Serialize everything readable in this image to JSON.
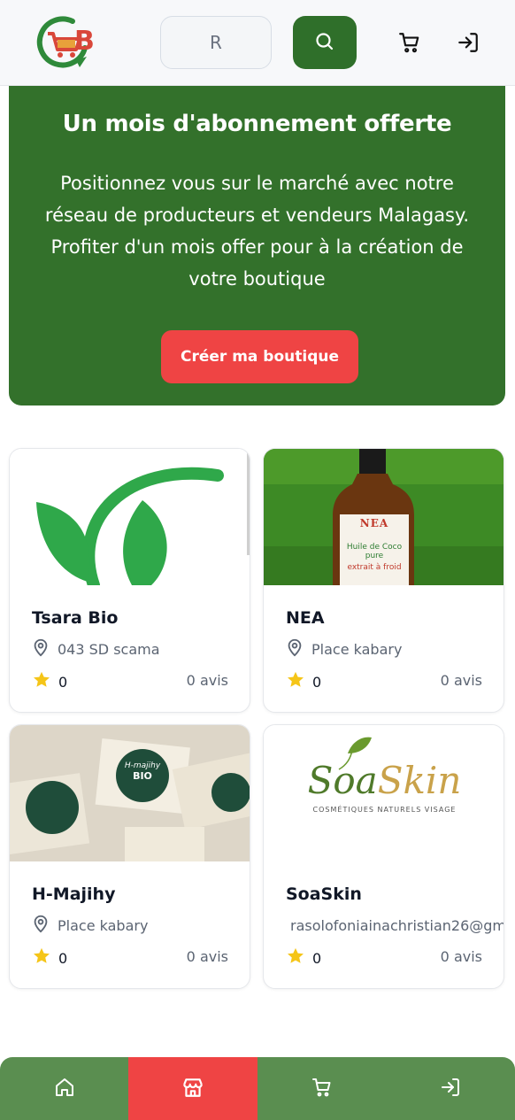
{
  "header": {
    "search_value": "R",
    "colors": {
      "brand_green": "#2f6f2a",
      "logo_red": "#d9473a"
    }
  },
  "promo": {
    "title": "Un mois d'abonnement offerte",
    "text_line_1": "Positionnez vous sur le marché avec notre",
    "text_line_2": "réseau de producteurs et vendeurs Malagasy.",
    "text_line_3": "Profiter d'un mois offer pour à la création de",
    "text_line_4": "votre boutique",
    "button_label": "Créer ma boutique",
    "background": "#33712b",
    "button_color": "#ef4444"
  },
  "shops": [
    {
      "name": "Tsara Bio",
      "location": "043 SD scama",
      "rating": "0",
      "reviews": "0 avis",
      "image": "leaf-logo"
    },
    {
      "name": "NEA",
      "location": "Place kabary",
      "rating": "0",
      "reviews": "0 avis",
      "image": "coconut-oil-bottle",
      "label_line_1": "NEA",
      "label_line_2": "Huile de Coco pure",
      "label_line_3": "extrait à froid"
    },
    {
      "name": "H-Majihy",
      "location": "Place kabary",
      "rating": "0",
      "reviews": "0 avis",
      "image": "soap-bars",
      "soap_text_1": "H-majihy",
      "soap_text_2": "BIO"
    },
    {
      "name": "SoaSkin",
      "location": "rasolofoniainachristian26@gm",
      "rating": "0",
      "reviews": "0 avis",
      "image": "soaskin-logo",
      "logo_word_1": "Soa",
      "logo_word_2": "Skin",
      "logo_tagline": "COSMÉTIQUES NATURELS VISAGE"
    }
  ],
  "icons": {
    "search": "search-icon",
    "cart": "cart-icon",
    "login": "login-icon",
    "location": "map-pin-icon",
    "star": "star-icon",
    "home": "home-icon",
    "store": "store-icon"
  },
  "bottom_nav": {
    "active": "store",
    "background": "#5a8e50",
    "active_color": "#ef4444"
  }
}
